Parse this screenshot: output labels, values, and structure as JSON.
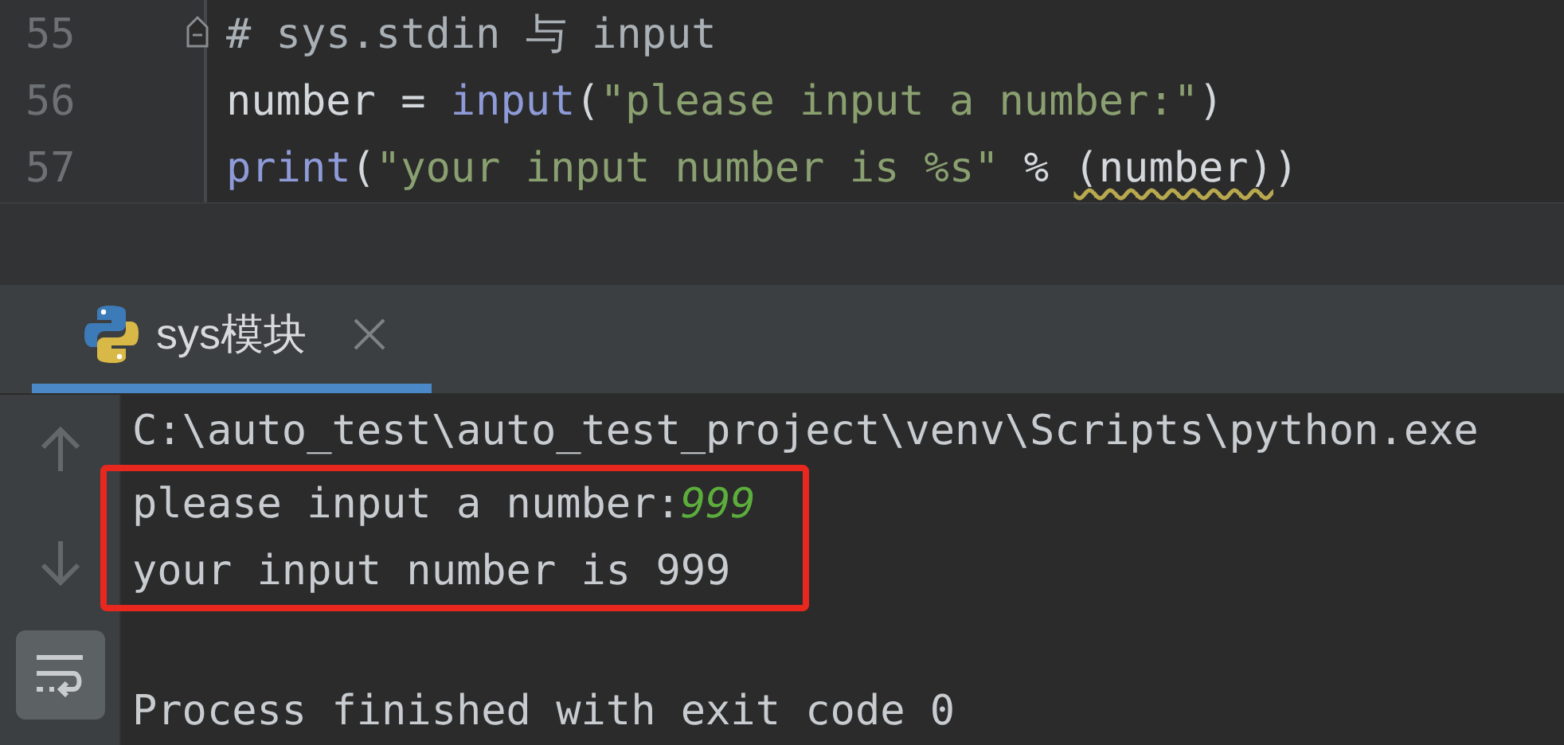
{
  "editor": {
    "lines": [
      {
        "number": "55",
        "fold": true,
        "tokens": [
          {
            "kind": "comment",
            "text": "# sys.stdin 与 input"
          }
        ]
      },
      {
        "number": "56",
        "fold": false,
        "tokens": [
          {
            "kind": "plain",
            "text": "number = "
          },
          {
            "kind": "builtin",
            "text": "input"
          },
          {
            "kind": "plain",
            "text": "("
          },
          {
            "kind": "string",
            "text": "\"please input a number:\""
          },
          {
            "kind": "plain",
            "text": ")"
          }
        ]
      },
      {
        "number": "57",
        "fold": false,
        "tokens": [
          {
            "kind": "builtin",
            "text": "print"
          },
          {
            "kind": "plain",
            "text": "("
          },
          {
            "kind": "string",
            "text": "\"your input number is %s\""
          },
          {
            "kind": "plain",
            "text": " % "
          },
          {
            "kind": "warning",
            "text": "(number)"
          },
          {
            "kind": "plain",
            "text": ")"
          }
        ]
      }
    ]
  },
  "run_tabs": [
    {
      "label": "sys模块",
      "selected": true
    }
  ],
  "toolbar": [
    {
      "kind": "up"
    },
    {
      "kind": "down"
    },
    {
      "kind": "wrap",
      "on": true
    }
  ],
  "console": {
    "lines": [
      {
        "highlighted": false,
        "segments": [
          {
            "kind": "output",
            "text": "C:\\auto_test\\auto_test_project\\venv\\Scripts\\python.exe"
          }
        ]
      },
      {
        "highlighted": true,
        "segments": [
          {
            "kind": "output",
            "text": "please input a number:"
          },
          {
            "kind": "user_input",
            "text": "999"
          }
        ]
      },
      {
        "highlighted": true,
        "segments": [
          {
            "kind": "output",
            "text": "your input number is 999"
          }
        ]
      },
      {
        "highlighted": false
      },
      {
        "highlighted": false,
        "segments": [
          {
            "kind": "output",
            "text": "Process finished with exit code 0"
          }
        ]
      }
    ]
  }
}
